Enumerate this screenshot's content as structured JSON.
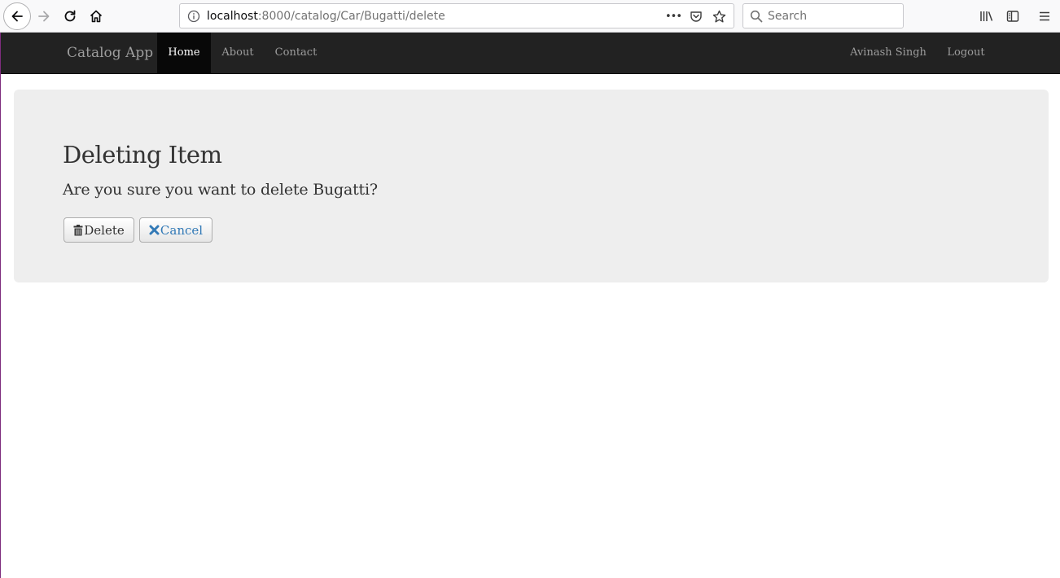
{
  "browser": {
    "url_host": "localhost",
    "url_rest": ":8000/catalog/Car/Bugatti/delete",
    "search_placeholder": "Search",
    "page_actions_label": "•••"
  },
  "navbar": {
    "brand": "Catalog App",
    "items": [
      {
        "label": "Home",
        "active": true
      },
      {
        "label": "About",
        "active": false
      },
      {
        "label": "Contact",
        "active": false
      }
    ],
    "right_items": [
      {
        "label": "Avinash Singh"
      },
      {
        "label": "Logout"
      }
    ]
  },
  "main": {
    "title": "Deleting Item",
    "question": "Are you sure you want to delete Bugatti?",
    "delete_label": "Delete",
    "cancel_label": "Cancel"
  },
  "colors": {
    "navbar_bg": "#222222",
    "jumbotron_bg": "#eeeeee",
    "link": "#337ab7"
  }
}
